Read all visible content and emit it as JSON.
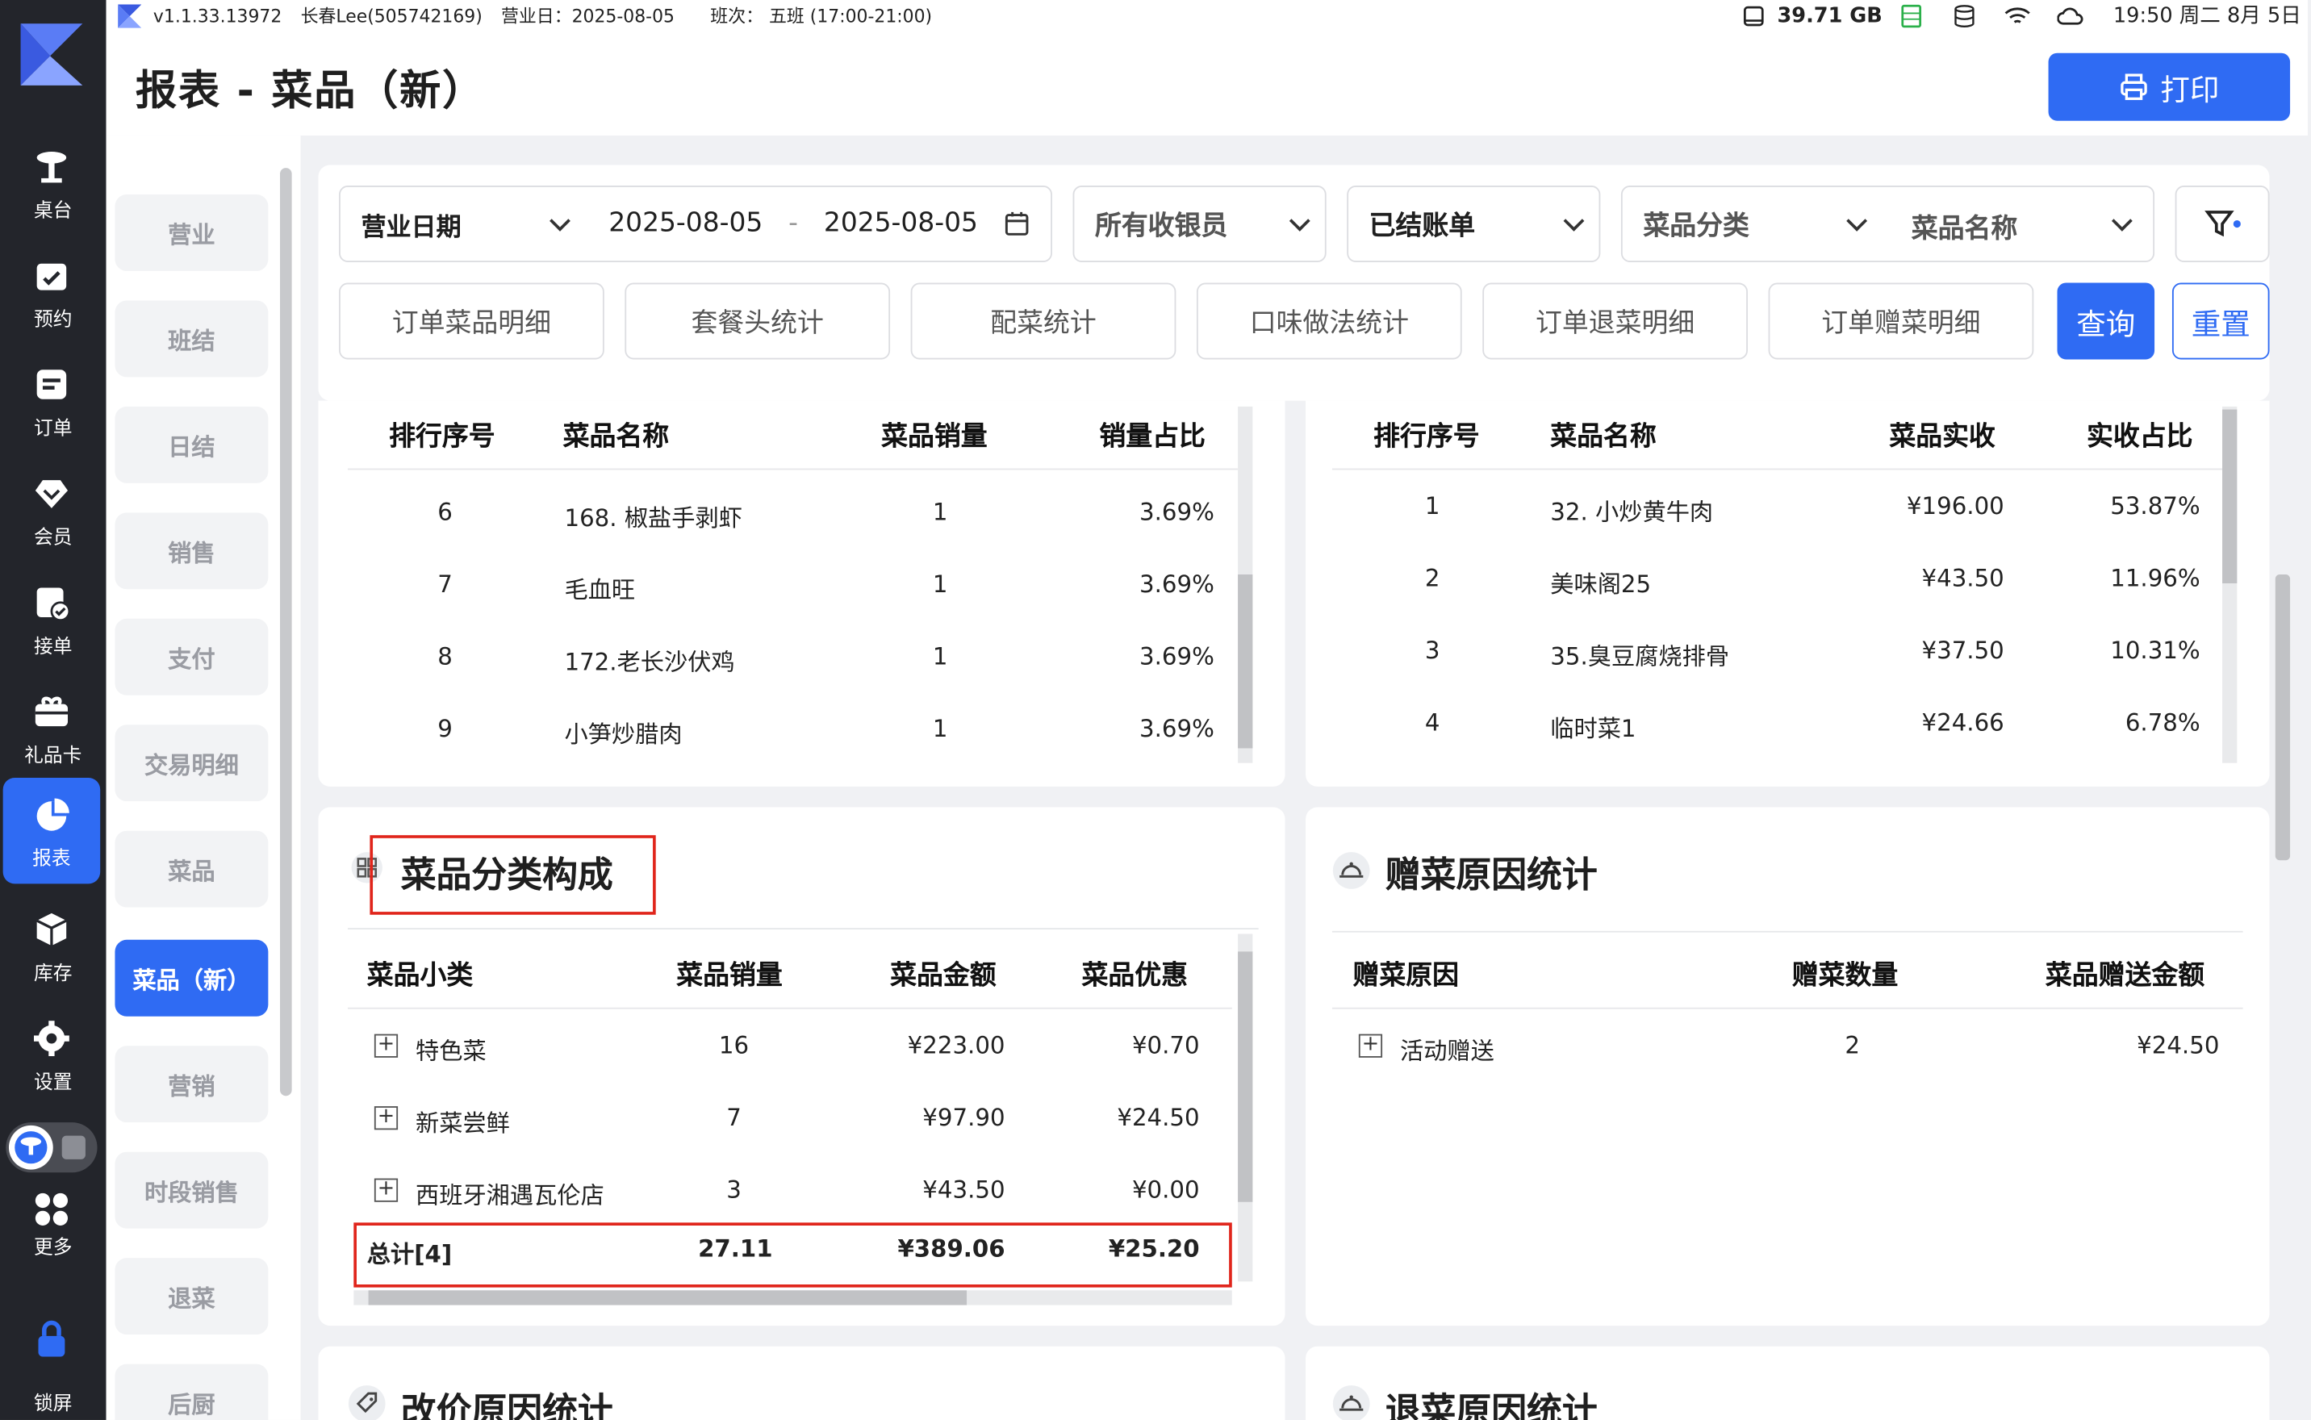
{
  "status_bar": {
    "version": "v1.1.33.13972",
    "user": "长春Lee(505742169)",
    "business_day": "营业日：2025-08-05",
    "shift": "班次：  五班 (17:00-21:00)",
    "storage": "39.71 GB",
    "clock": "19:50 周二 8月 5日"
  },
  "nav": {
    "items": [
      {
        "label": "桌台",
        "icon": "table-icon"
      },
      {
        "label": "预约",
        "icon": "calendar-icon"
      },
      {
        "label": "订单",
        "icon": "order-icon"
      },
      {
        "label": "会员",
        "icon": "member-icon"
      },
      {
        "label": "接单",
        "icon": "accept-order-icon"
      },
      {
        "label": "礼品卡",
        "icon": "gift-card-icon"
      },
      {
        "label": "报表",
        "icon": "report-icon",
        "active": true
      },
      {
        "label": "库存",
        "icon": "inventory-icon"
      },
      {
        "label": "设置",
        "icon": "settings-icon"
      },
      {
        "label": "更多",
        "icon": "more-icon"
      },
      {
        "label": "锁屏",
        "icon": "lock-icon"
      }
    ]
  },
  "header": {
    "title": "报表 - 菜品（新）",
    "print_label": "打印"
  },
  "subnav": {
    "items": [
      "营业",
      "班结",
      "日结",
      "销售",
      "支付",
      "交易明细",
      "菜品",
      "菜品（新）",
      "营销",
      "时段销售",
      "退菜",
      "后厨"
    ],
    "active_index": 7
  },
  "filters": {
    "date_type": "营业日期",
    "date_from": "2025-08-05",
    "date_sep": "-",
    "date_to": "2025-08-05",
    "cashier": "所有收银员",
    "bill_status": "已结账单",
    "category": "菜品分类",
    "dish_name": "菜品名称",
    "tabs": [
      "订单菜品明细",
      "套餐头统计",
      "配菜统计",
      "口味做法统计",
      "订单退菜明细",
      "订单赠菜明细"
    ],
    "query_label": "查询",
    "reset_label": "重置"
  },
  "sales_rank": {
    "headers": [
      "排行序号",
      "菜品名称",
      "菜品销量",
      "销量占比"
    ],
    "rows": [
      [
        "6",
        "168. 椒盐手剥虾",
        "1",
        "3.69%"
      ],
      [
        "7",
        "毛血旺",
        "1",
        "3.69%"
      ],
      [
        "8",
        "172.老长沙伏鸡",
        "1",
        "3.69%"
      ],
      [
        "9",
        "小笋炒腊肉",
        "1",
        "3.69%"
      ]
    ]
  },
  "revenue_rank": {
    "headers": [
      "排行序号",
      "菜品名称",
      "菜品实收",
      "实收占比"
    ],
    "rows": [
      [
        "1",
        "32. 小炒黄牛肉",
        "¥196.00",
        "53.87%"
      ],
      [
        "2",
        "美味阁25",
        "¥43.50",
        "11.96%"
      ],
      [
        "3",
        "35.臭豆腐烧排骨",
        "¥37.50",
        "10.31%"
      ],
      [
        "4",
        "临时菜1",
        "¥24.66",
        "6.78%"
      ]
    ]
  },
  "category_card": {
    "title": "菜品分类构成",
    "headers": [
      "菜品小类",
      "菜品销量",
      "菜品金额",
      "菜品优惠"
    ],
    "rows": [
      [
        "特色菜",
        "16",
        "¥223.00",
        "¥0.70"
      ],
      [
        "新菜尝鲜",
        "7",
        "¥97.90",
        "¥24.50"
      ],
      [
        "西班牙湘遇瓦伦店",
        "3",
        "¥43.50",
        "¥0.00"
      ]
    ],
    "total": [
      "总计[4]",
      "27.11",
      "¥389.06",
      "¥25.20"
    ]
  },
  "gift_card": {
    "title": "赠菜原因统计",
    "headers": [
      "赠菜原因",
      "赠菜数量",
      "菜品赠送金额"
    ],
    "rows": [
      [
        "活动赠送",
        "2",
        "¥24.50"
      ]
    ]
  },
  "price_change_card": {
    "title": "改价原因统计"
  },
  "return_card": {
    "title": "退菜原因统计"
  },
  "colors": {
    "accent": "#2f6bf3",
    "sidebar": "#23252b",
    "highlight_box": "#e0251b"
  }
}
